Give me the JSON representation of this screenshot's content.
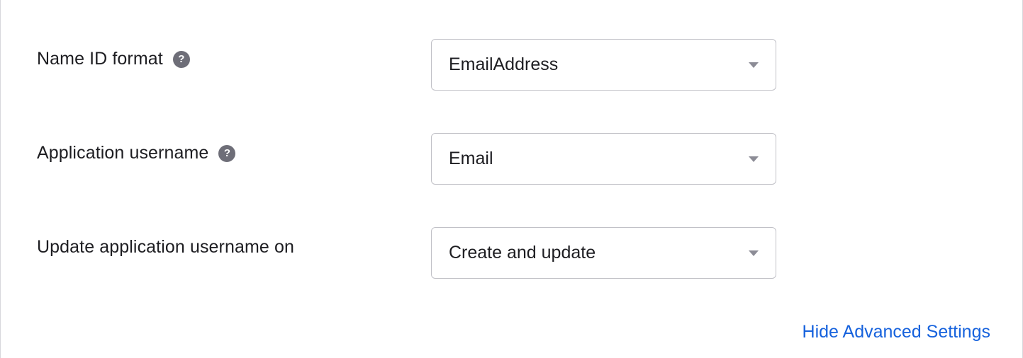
{
  "fields": {
    "name_id_format": {
      "label": "Name ID format",
      "has_help": true,
      "value": "EmailAddress"
    },
    "application_username": {
      "label": "Application username",
      "has_help": true,
      "value": "Email"
    },
    "update_application_username_on": {
      "label": "Update application username on",
      "has_help": false,
      "value": "Create and update"
    }
  },
  "footer": {
    "toggle_advanced_label": "Hide Advanced Settings"
  }
}
